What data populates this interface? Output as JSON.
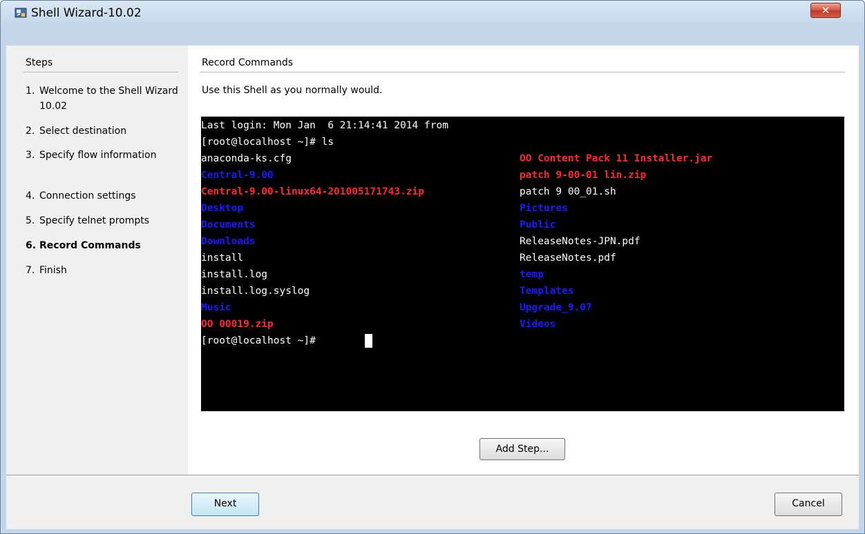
{
  "window": {
    "title": "Shell Wizard-10.02",
    "close_label": "✕"
  },
  "sidebar": {
    "heading": "Steps",
    "steps": [
      {
        "num": "1.",
        "label": "Welcome to the Shell Wizard 10.02"
      },
      {
        "num": "2.",
        "label": "Select destination"
      },
      {
        "num": "3.",
        "label": "Specify flow information"
      },
      {
        "num": "4.",
        "label": "Connection settings"
      },
      {
        "num": "5.",
        "label": "Specify telnet prompts"
      },
      {
        "num": "6.",
        "label": "Record Commands"
      },
      {
        "num": "7.",
        "label": "Finish"
      }
    ],
    "active_step": 6
  },
  "main": {
    "heading": "Record Commands",
    "instruction": "Use this Shell as you normally would."
  },
  "terminal": {
    "colors": {
      "background": "#000000",
      "plain": "#ffffff",
      "archive": "#ff2a2a",
      "directory": "#1a1aff"
    },
    "lines": [
      "Last login: Mon Jan  6 21:14:41 2014 from",
      "[root@localhost ~]# ls"
    ],
    "ls_col1": [
      {
        "text": "anaconda-ks.cfg",
        "kind": "white"
      },
      {
        "text": "Central-9.00",
        "kind": "blue"
      },
      {
        "text": "Central-9.00-linux64-201005171743.zip",
        "kind": "red"
      },
      {
        "text": "Desktop",
        "kind": "blue"
      },
      {
        "text": "Documents",
        "kind": "blue"
      },
      {
        "text": "Downloads",
        "kind": "blue"
      },
      {
        "text": "install",
        "kind": "white"
      },
      {
        "text": "install.log",
        "kind": "white"
      },
      {
        "text": "install.log.syslog",
        "kind": "white"
      },
      {
        "text": "Music",
        "kind": "blue"
      },
      {
        "text": "OO 00019.zip",
        "kind": "red"
      }
    ],
    "ls_col2": [
      {
        "text": "OO Content Pack 11 Installer.jar",
        "kind": "red"
      },
      {
        "text": "patch 9-00-01 lin.zip",
        "kind": "red"
      },
      {
        "text": "patch 9 00_01.sh",
        "kind": "white"
      },
      {
        "text": "Pictures",
        "kind": "blue"
      },
      {
        "text": "Public",
        "kind": "blue"
      },
      {
        "text": "ReleaseNotes-JPN.pdf",
        "kind": "white"
      },
      {
        "text": "ReleaseNotes.pdf",
        "kind": "white"
      },
      {
        "text": "temp",
        "kind": "blue"
      },
      {
        "text": "Templates",
        "kind": "blue"
      },
      {
        "text": "Upgrade_9.07",
        "kind": "blue"
      },
      {
        "text": "Videos",
        "kind": "blue"
      }
    ],
    "prompt": "[root@localhost ~]# "
  },
  "buttons": {
    "add_step": "Add Step...",
    "next": "Next",
    "cancel": "Cancel"
  }
}
